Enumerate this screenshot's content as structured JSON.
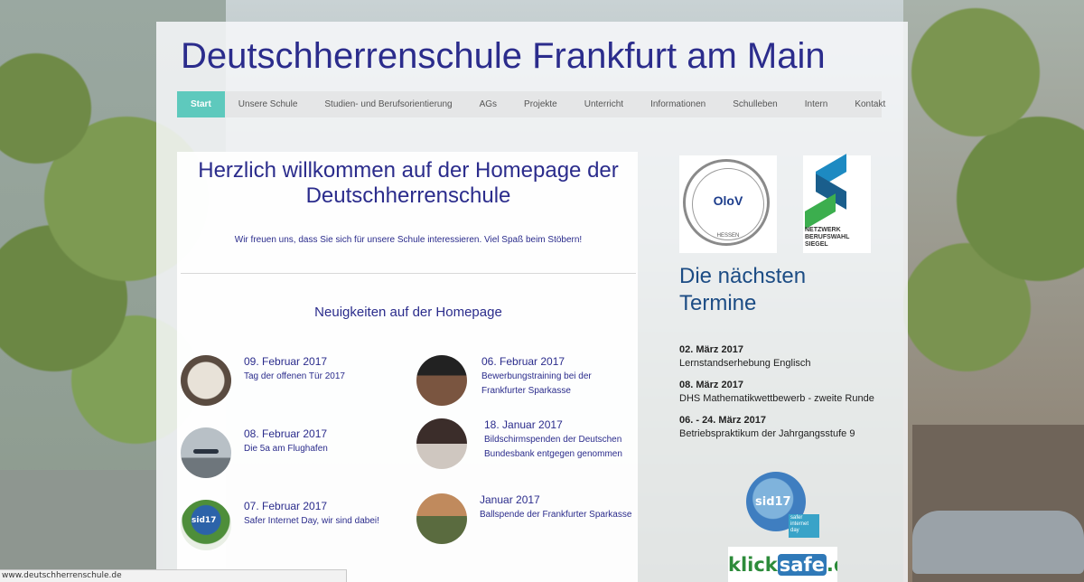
{
  "site": {
    "title": "Deutschherrenschule Frankfurt am Main"
  },
  "nav": {
    "items": [
      {
        "label": "Start",
        "active": true
      },
      {
        "label": "Unsere Schule"
      },
      {
        "label": "Studien- und Berufsorientierung"
      },
      {
        "label": "AGs"
      },
      {
        "label": "Projekte"
      },
      {
        "label": "Unterricht"
      },
      {
        "label": "Informationen"
      },
      {
        "label": "Schulleben"
      },
      {
        "label": "Intern"
      },
      {
        "label": "Kontakt"
      }
    ]
  },
  "welcome": {
    "title": "Herzlich willkommen auf der Homepage der Deutschherrenschule",
    "text": "Wir freuen uns, dass Sie sich für unsere Schule interessieren. Viel Spaß beim Stöbern!"
  },
  "news": {
    "heading": "Neuigkeiten auf der Homepage",
    "items": [
      {
        "date": "09. Februar 2017",
        "text": "Tag der offenen Tür 2017"
      },
      {
        "date": "06. Februar 2017",
        "text": "Bewerbungstraining bei der Frankfurter Sparkasse"
      },
      {
        "date": "08. Februar 2017",
        "text": "Die 5a am Flughafen"
      },
      {
        "date": "18. Januar 2017",
        "text": "Bildschirmspenden der Deutschen Bundesbank entgegen genommen"
      },
      {
        "date": "07. Februar 2017",
        "text": "Safer Internet Day, wir sind dabei!"
      },
      {
        "date": "Januar 2017",
        "text": "Ballspende der Frankfurter Sparkasse"
      }
    ]
  },
  "sidebar": {
    "olov_logo": {
      "text": "OloV",
      "small": "HESSEN"
    },
    "netzwerk_logo": {
      "text": "NETZWERK BERUFSWAHL SIEGEL"
    },
    "termine_heading": "Die nächsten Termine",
    "termine": [
      {
        "date": "02. März 2017",
        "desc": "Lernstandserhebung Englisch"
      },
      {
        "date": "08. März 2017",
        "desc": "DHS Mathematikwettbewerb - zweite Runde"
      },
      {
        "date": "06. - 24. März 2017",
        "desc": "Betriebspraktikum der Jahrgangsstufe 9"
      }
    ],
    "sid_logo": {
      "label": "sid17",
      "tag": "safer internet day"
    },
    "klicksafe": {
      "part1": "klick",
      "part2": "safe",
      "part3": ".de"
    }
  },
  "statusbar": {
    "url": "www.deutschherrenschule.de"
  },
  "colors": {
    "accent": "#5ec9bd",
    "title": "#2b2c8c",
    "termine_heading": "#1c4c84"
  }
}
